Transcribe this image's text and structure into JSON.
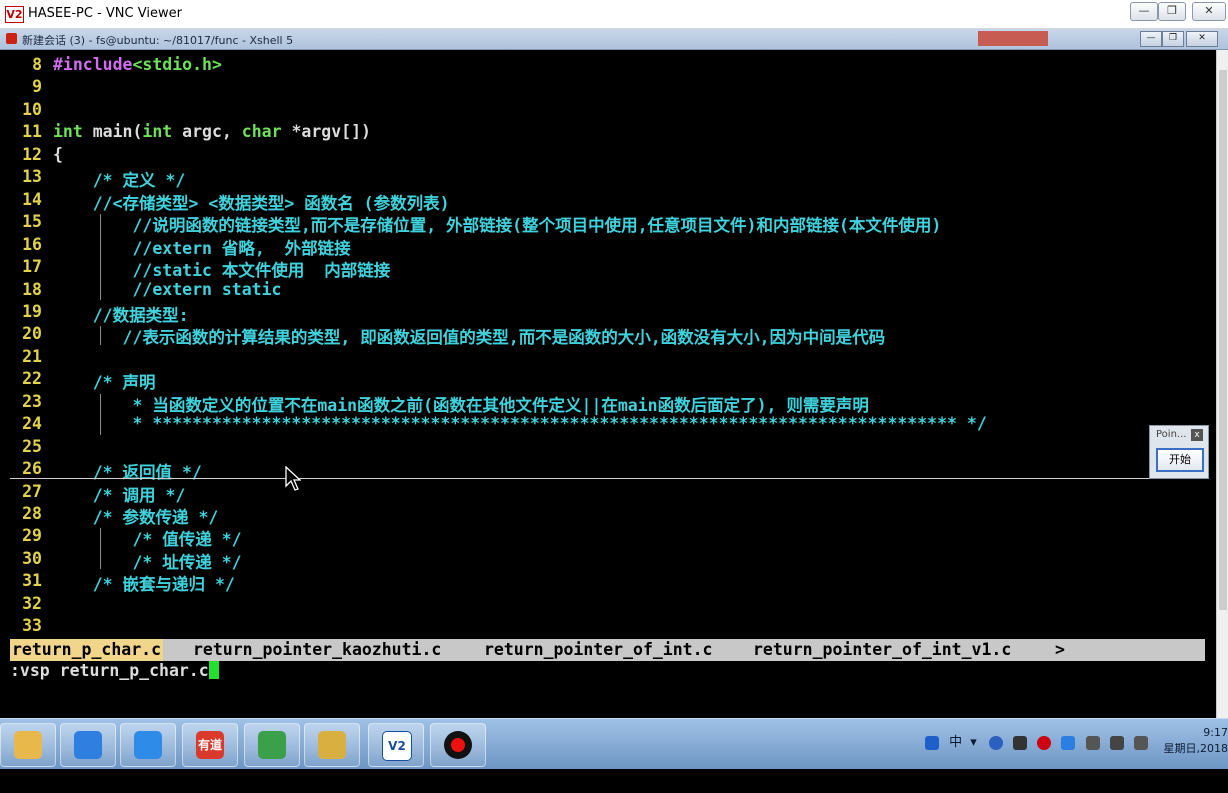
{
  "vnc_window": {
    "title": "HASEE-PC - VNC Viewer",
    "minimize": "—",
    "maximize": "❐",
    "close": "✕"
  },
  "xshell": {
    "title": "新建会话 (3) - fs@ubuntu: ~/81017/func - Xshell 5",
    "minimize": "—",
    "maximize": "❐",
    "close": "✕"
  },
  "editor": {
    "lines": [
      {
        "num": "8",
        "text": "#include<stdio.h>",
        "kind": "include"
      },
      {
        "num": "9",
        "text": ""
      },
      {
        "num": "10",
        "text": ""
      },
      {
        "num": "11",
        "text": "int main(int argc, char *argv[])",
        "kind": "main"
      },
      {
        "num": "12",
        "text": "{",
        "kind": "plain"
      },
      {
        "num": "13",
        "text": "    /* 定义 */"
      },
      {
        "num": "14",
        "text": "    //<存储类型> <数据类型> 函数名 (参数列表)"
      },
      {
        "num": "15",
        "text": "        //说明函数的链接类型,而不是存储位置, 外部链接(整个项目中使用,任意项目文件)和内部链接(本文件使用)"
      },
      {
        "num": "16",
        "text": "        //extern 省略,  外部链接"
      },
      {
        "num": "17",
        "text": "        //static 本文件使用  内部链接"
      },
      {
        "num": "18",
        "text": "        //extern static"
      },
      {
        "num": "19",
        "text": "    //数据类型:"
      },
      {
        "num": "20",
        "text": "       //表示函数的计算结果的类型, 即函数返回值的类型,而不是函数的大小,函数没有大小,因为中间是代码"
      },
      {
        "num": "21",
        "text": ""
      },
      {
        "num": "22",
        "text": "    /* 声明"
      },
      {
        "num": "23",
        "text": "        * 当函数定义的位置不在main函数之前(函数在其他文件定义||在main函数后面定了), 则需要声明"
      },
      {
        "num": "24",
        "text": "        * ********************************************************************************* */"
      },
      {
        "num": "25",
        "text": ""
      },
      {
        "num": "26",
        "text": "    /* 返回值 */"
      },
      {
        "num": "27",
        "text": "    /* 调用 */"
      },
      {
        "num": "28",
        "text": "    /* 参数传递 */"
      },
      {
        "num": "29",
        "text": "        /* 值传递 */"
      },
      {
        "num": "30",
        "text": "        /* 址传递 */"
      },
      {
        "num": "31",
        "text": "    /* 嵌套与递归 */"
      },
      {
        "num": "32",
        "text": ""
      },
      {
        "num": "33",
        "text": ""
      }
    ],
    "main_tokens": [
      "int",
      " main(",
      "int",
      " argc, ",
      "char",
      " *argv[])"
    ],
    "tabs": [
      "return_p_char.c",
      "return_pointer_kaozhuti.c",
      "return_pointer_of_int.c",
      "return_pointer_of_int_v1.c",
      ">"
    ],
    "command": ":vsp return_p_char.c"
  },
  "popup": {
    "title": "Poin...",
    "close": "x",
    "button": "开始"
  },
  "taskbar": {
    "apps": [
      {
        "name": "file-explorer",
        "label": "",
        "color": "#e8b84a"
      },
      {
        "name": "baidu-cloud",
        "label": "",
        "color": "#2f7fe0"
      },
      {
        "name": "notes",
        "label": "",
        "color": "#2f8be8"
      },
      {
        "name": "youdao-dict",
        "label": "有道",
        "color": "#d93a2c"
      },
      {
        "name": "chrome",
        "label": "",
        "color": "#3aa04a"
      },
      {
        "name": "file-manager",
        "label": "",
        "color": "#d9b040"
      },
      {
        "name": "vnc-viewer",
        "label": "V2",
        "color": "#ffffff"
      },
      {
        "name": "recorder",
        "label": "",
        "color": "#111111"
      }
    ],
    "tray_ime": "中",
    "clock_time": "9:17",
    "clock_date": "星期日,2018"
  },
  "colors": {
    "comment": "#3fd2dc",
    "linenum": "#e3d34a",
    "tab_active": "#f0d58a"
  }
}
